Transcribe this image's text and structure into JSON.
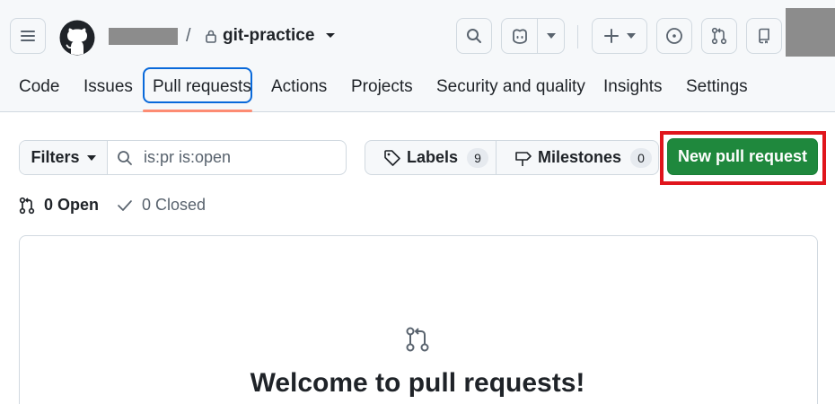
{
  "header": {
    "repo_name": "git-practice",
    "separator": "/"
  },
  "tabs": [
    {
      "label": "Code"
    },
    {
      "label": "Issues"
    },
    {
      "label": "Pull requests",
      "active": true
    },
    {
      "label": "Actions"
    },
    {
      "label": "Projects"
    },
    {
      "label": "Security and quality"
    },
    {
      "label": "Insights"
    },
    {
      "label": "Settings"
    }
  ],
  "toolbar": {
    "filters_label": "Filters",
    "search_value": "is:pr is:open",
    "labels_label": "Labels",
    "labels_count": "9",
    "milestones_label": "Milestones",
    "milestones_count": "0",
    "new_pr_label": "New pull request"
  },
  "states": {
    "open_label": "0 Open",
    "closed_label": "0 Closed"
  },
  "blankslate": {
    "title": "Welcome to pull requests!"
  },
  "colors": {
    "primary_button": "#1f883d",
    "highlight_box": "#e0151c",
    "active_tab_border": "#0969da",
    "tab_underline": "#fd8c73"
  }
}
